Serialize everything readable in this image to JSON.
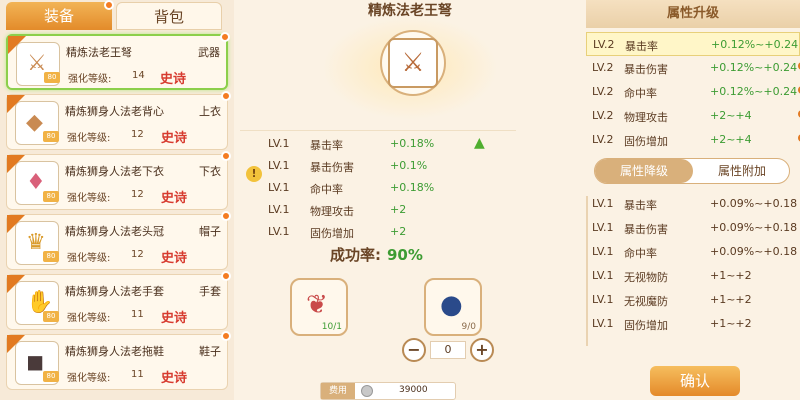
{
  "tabs": {
    "equip": "装备",
    "bag": "背包"
  },
  "items": [
    {
      "name": "精炼法老王弩",
      "slot": "武器",
      "lv_label": "强化等级:",
      "lv": "14",
      "rarity": "史诗",
      "glyph": "⚔"
    },
    {
      "name": "精炼狮身人法老背心",
      "slot": "上衣",
      "lv_label": "强化等级:",
      "lv": "12",
      "rarity": "史诗",
      "glyph": "◆"
    },
    {
      "name": "精炼狮身人法老下衣",
      "slot": "下衣",
      "lv_label": "强化等级:",
      "lv": "12",
      "rarity": "史诗",
      "glyph": "♦"
    },
    {
      "name": "精炼狮身人法老头冠",
      "slot": "帽子",
      "lv_label": "强化等级:",
      "lv": "12",
      "rarity": "史诗",
      "glyph": "♛"
    },
    {
      "name": "精炼狮身人法老手套",
      "slot": "手套",
      "lv_label": "强化等级:",
      "lv": "11",
      "rarity": "史诗",
      "glyph": "✋"
    },
    {
      "name": "精炼狮身人法老拖鞋",
      "slot": "鞋子",
      "lv_label": "强化等级:",
      "lv": "11",
      "rarity": "史诗",
      "glyph": "◼"
    }
  ],
  "center": {
    "title": "精炼法老王弩",
    "main_glyph": "⚔",
    "stats": [
      {
        "lv": "LV.1",
        "name": "暴击率",
        "value": "+0.18%"
      },
      {
        "lv": "LV.1",
        "name": "暴击伤害",
        "value": "+0.1%"
      },
      {
        "lv": "LV.1",
        "name": "命中率",
        "value": "+0.18%"
      },
      {
        "lv": "LV.1",
        "name": "物理攻击",
        "value": "+2"
      },
      {
        "lv": "LV.1",
        "name": "固伤增加",
        "value": "+2"
      }
    ],
    "success_label": "成功率:",
    "success_value": "90%",
    "mat1_count": "10/1",
    "mat2_count": "9/0",
    "stepper_value": "0",
    "cost_label": "费用",
    "cost_value": "39000"
  },
  "right": {
    "header": "属性升级",
    "upgrade": [
      {
        "lv": "LV.2",
        "name": "暴击率",
        "value": "+0.12%~+0.24"
      },
      {
        "lv": "LV.2",
        "name": "暴击伤害",
        "value": "+0.12%~+0.24"
      },
      {
        "lv": "LV.2",
        "name": "命中率",
        "value": "+0.12%~+0.24"
      },
      {
        "lv": "LV.2",
        "name": "物理攻击",
        "value": "+2~+4"
      },
      {
        "lv": "LV.2",
        "name": "固伤增加",
        "value": "+2~+4"
      }
    ],
    "subtab_a": "属性降级",
    "subtab_b": "属性附加",
    "extra": [
      {
        "lv": "LV.1",
        "name": "暴击率",
        "value": "+0.09%~+0.18"
      },
      {
        "lv": "LV.1",
        "name": "暴击伤害",
        "value": "+0.09%~+0.18"
      },
      {
        "lv": "LV.1",
        "name": "命中率",
        "value": "+0.09%~+0.18"
      },
      {
        "lv": "LV.1",
        "name": "无视物防",
        "value": "+1~+2"
      },
      {
        "lv": "LV.1",
        "name": "无视魔防",
        "value": "+1~+2"
      },
      {
        "lv": "LV.1",
        "name": "固伤增加",
        "value": "+1~+2"
      }
    ],
    "confirm": "确认"
  },
  "colors": {
    "accent": "#e38b2a",
    "epic": "#d73b2f",
    "bonus": "#3d9c33"
  }
}
